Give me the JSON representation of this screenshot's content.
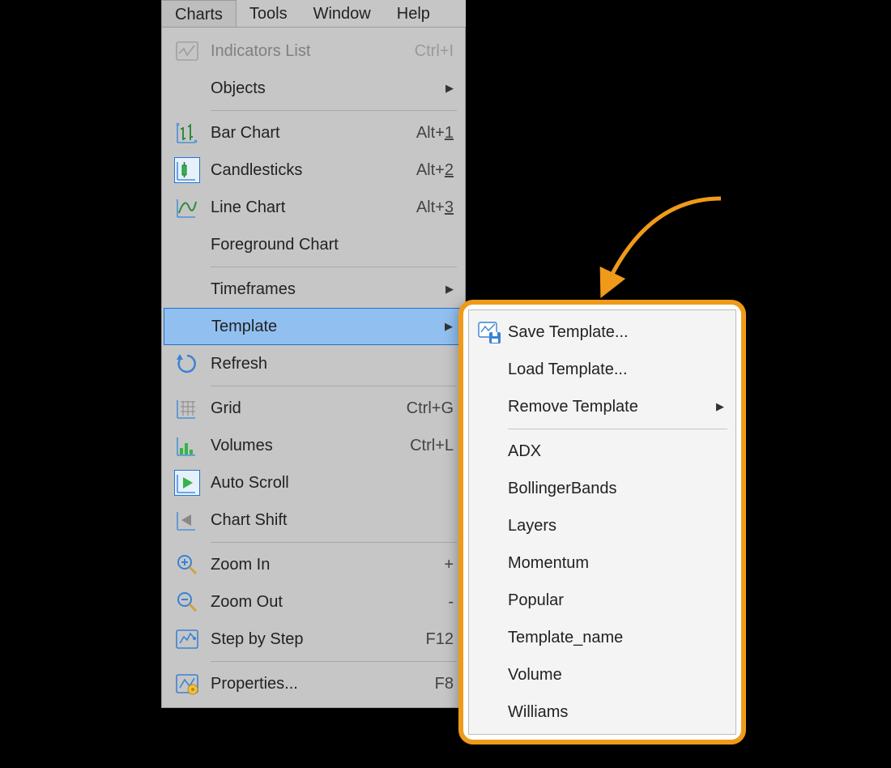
{
  "menubar": {
    "items": [
      {
        "label": "Charts",
        "active": true
      },
      {
        "label": "Tools",
        "active": false
      },
      {
        "label": "Window",
        "active": false
      },
      {
        "label": "Help",
        "active": false
      }
    ]
  },
  "dropdown": {
    "groups": [
      [
        {
          "key": "indicators",
          "label": "Indicators List",
          "shortcut": "Ctrl+I",
          "icon": "indicators-icon",
          "disabled": true
        },
        {
          "key": "objects",
          "label": "Objects",
          "submenu": true
        }
      ],
      [
        {
          "key": "bar-chart",
          "label": "Bar Chart",
          "shortcut_base": "Alt+",
          "shortcut_key": "1",
          "icon": "bar-chart-icon"
        },
        {
          "key": "candlesticks",
          "label": "Candlesticks",
          "shortcut_base": "Alt+",
          "shortcut_key": "2",
          "icon": "candlestick-icon",
          "selected": true
        },
        {
          "key": "line-chart",
          "label": "Line Chart",
          "shortcut_base": "Alt+",
          "shortcut_key": "3",
          "icon": "line-chart-icon"
        },
        {
          "key": "foreground",
          "label": "Foreground Chart"
        }
      ],
      [
        {
          "key": "timeframes",
          "label": "Timeframes",
          "submenu": true
        },
        {
          "key": "template",
          "label": "Template",
          "submenu": true,
          "highlight": true
        },
        {
          "key": "refresh",
          "label": "Refresh",
          "icon": "refresh-icon"
        }
      ],
      [
        {
          "key": "grid",
          "label": "Grid",
          "shortcut": "Ctrl+G",
          "icon": "grid-icon"
        },
        {
          "key": "volumes",
          "label": "Volumes",
          "shortcut": "Ctrl+L",
          "icon": "volumes-icon"
        },
        {
          "key": "auto-scroll",
          "label": "Auto Scroll",
          "icon": "auto-scroll-icon",
          "selected": true
        },
        {
          "key": "chart-shift",
          "label": "Chart Shift",
          "icon": "chart-shift-icon"
        }
      ],
      [
        {
          "key": "zoom-in",
          "label": "Zoom In",
          "shortcut": "+",
          "icon": "zoom-in-icon"
        },
        {
          "key": "zoom-out",
          "label": "Zoom Out",
          "shortcut": "-",
          "icon": "zoom-out-icon"
        },
        {
          "key": "step-by-step",
          "label": "Step by Step",
          "shortcut": "F12",
          "icon": "step-icon"
        }
      ],
      [
        {
          "key": "properties",
          "label": "Properties...",
          "shortcut": "F8",
          "icon": "properties-icon"
        }
      ]
    ]
  },
  "submenu": {
    "groups": [
      [
        {
          "key": "save-template",
          "label": "Save Template...",
          "icon": "save-template-icon"
        },
        {
          "key": "load-template",
          "label": "Load Template..."
        },
        {
          "key": "remove-template",
          "label": "Remove Template",
          "submenu": true
        }
      ],
      [
        {
          "key": "t-adx",
          "label": "ADX"
        },
        {
          "key": "t-bb",
          "label": "BollingerBands"
        },
        {
          "key": "t-layers",
          "label": "Layers"
        },
        {
          "key": "t-momentum",
          "label": "Momentum"
        },
        {
          "key": "t-popular",
          "label": "Popular"
        },
        {
          "key": "t-name",
          "label": "Template_name"
        },
        {
          "key": "t-volume",
          "label": "Volume"
        },
        {
          "key": "t-williams",
          "label": "Williams"
        }
      ]
    ]
  }
}
